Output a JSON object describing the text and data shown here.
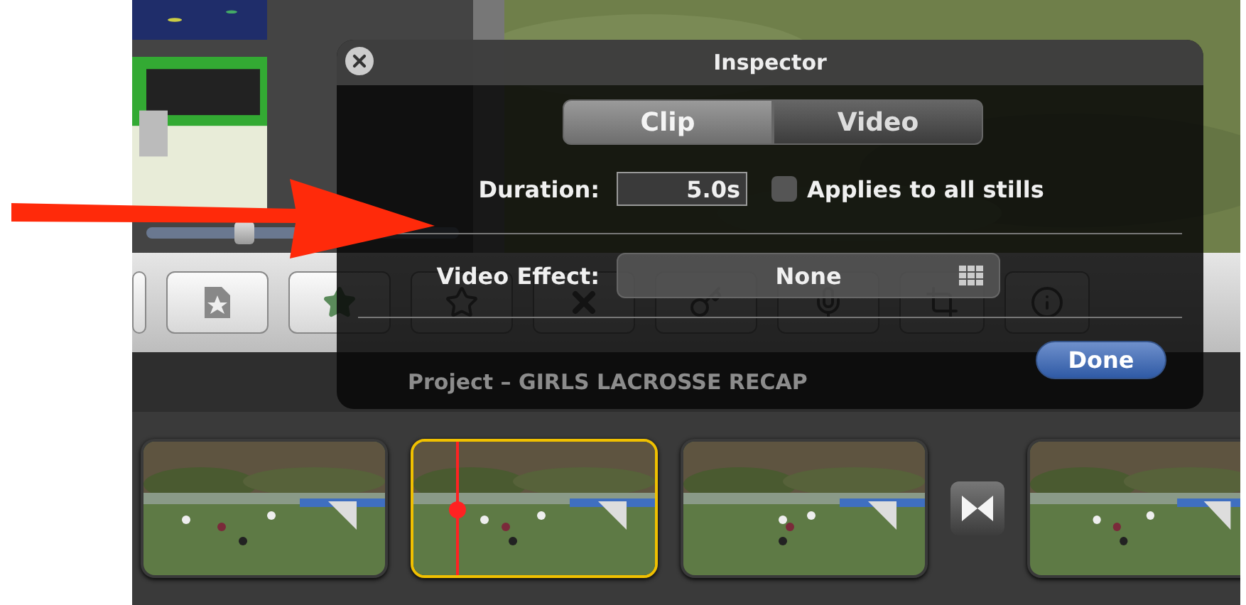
{
  "inspector": {
    "title": "Inspector",
    "tabs": [
      {
        "label": "Clip",
        "selected": true
      },
      {
        "label": "Video",
        "selected": false
      }
    ],
    "duration": {
      "label": "Duration:",
      "value": "5.0s"
    },
    "applies_to_all_stills": {
      "label": "Applies to all stills",
      "checked": false
    },
    "video_effect": {
      "label": "Video Effect:",
      "value": "None"
    },
    "done_button": "Done"
  },
  "project": {
    "title": "Project – GIRLS LACROSSE RECAP"
  },
  "library": [
    {
      "kind": "picture"
    },
    {
      "kind": "picture"
    }
  ],
  "zoom_slider": {
    "level": 0.3
  },
  "clips": [
    {
      "kind": "picture",
      "selected": false
    },
    {
      "kind": "picture",
      "selected": true
    },
    {
      "kind": "picture",
      "selected": false
    },
    {
      "kind": "transition"
    },
    {
      "kind": "picture",
      "selected": false
    }
  ]
}
